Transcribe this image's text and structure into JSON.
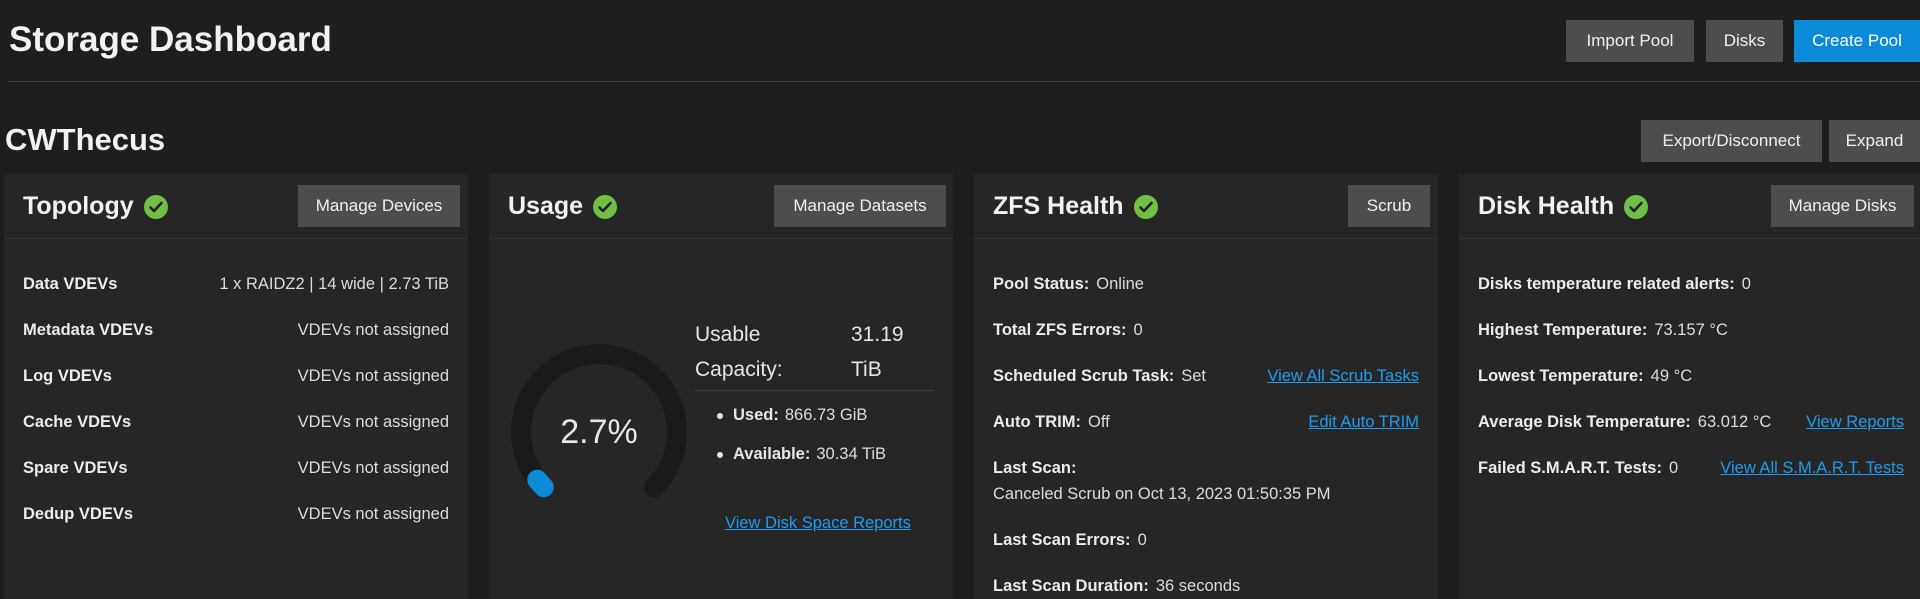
{
  "header": {
    "title": "Storage Dashboard",
    "import_pool": "Import Pool",
    "disks": "Disks",
    "create_pool": "Create Pool"
  },
  "pool": {
    "name": "CWThecus",
    "export_disconnect": "Export/Disconnect",
    "expand": "Expand"
  },
  "topology": {
    "title": "Topology",
    "button": "Manage Devices",
    "rows": [
      {
        "label": "Data VDEVs",
        "value": "1 x RAIDZ2 | 14 wide | 2.73 TiB"
      },
      {
        "label": "Metadata VDEVs",
        "value": "VDEVs not assigned"
      },
      {
        "label": "Log VDEVs",
        "value": "VDEVs not assigned"
      },
      {
        "label": "Cache VDEVs",
        "value": "VDEVs not assigned"
      },
      {
        "label": "Spare VDEVs",
        "value": "VDEVs not assigned"
      },
      {
        "label": "Dedup VDEVs",
        "value": "VDEVs not assigned"
      }
    ]
  },
  "usage": {
    "title": "Usage",
    "button": "Manage Datasets",
    "percent_text": "2.7%",
    "percent_value": 2.7,
    "capacity_label_1": "Usable",
    "capacity_label_2": "Capacity:",
    "capacity_value_1": "31.19",
    "capacity_value_2": "TiB",
    "used_label": "Used:",
    "used_value": "866.73 GiB",
    "available_label": "Available:",
    "available_value": "30.34 TiB",
    "reports_link": "View Disk Space Reports",
    "gauge_color": "#0b8ad8",
    "gauge_track": "#1a1a1a"
  },
  "zfs": {
    "title": "ZFS Health",
    "button": "Scrub",
    "pool_status_label": "Pool Status:",
    "pool_status_value": "Online",
    "errors_label": "Total ZFS Errors:",
    "errors_value": "0",
    "scrub_task_label": "Scheduled Scrub Task:",
    "scrub_task_value": "Set",
    "scrub_task_link": "View All Scrub Tasks",
    "trim_label": "Auto TRIM:",
    "trim_value": "Off",
    "trim_link": "Edit Auto TRIM",
    "last_scan_label": "Last Scan:",
    "last_scan_value": "Canceled Scrub on Oct 13, 2023 01:50:35 PM",
    "scan_errors_label": "Last Scan Errors:",
    "scan_errors_value": "0",
    "scan_duration_label": "Last Scan Duration:",
    "scan_duration_value": "36 seconds"
  },
  "disk_health": {
    "title": "Disk Health",
    "button": "Manage Disks",
    "temp_alerts_label": "Disks temperature related alerts:",
    "temp_alerts_value": "0",
    "highest_label": "Highest Temperature:",
    "highest_value": "73.157 °C",
    "lowest_label": "Lowest Temperature:",
    "lowest_value": "49 °C",
    "average_label": "Average Disk Temperature:",
    "average_value": "63.012 °C",
    "reports_link": "View Reports",
    "smart_label": "Failed S.M.A.R.T. Tests:",
    "smart_value": "0",
    "smart_link": "View All S.M.A.R.T. Tests"
  },
  "colors": {
    "accent": "#0b8ad8",
    "healthy": "#71bf44",
    "link": "#1e9bf0"
  }
}
